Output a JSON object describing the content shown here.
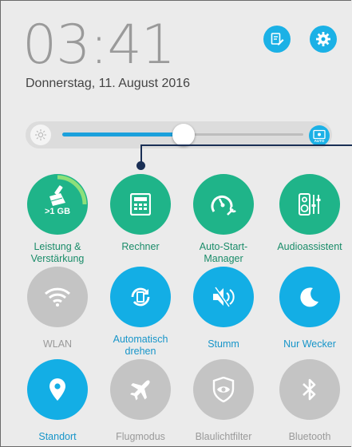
{
  "clock": {
    "time": "03:41",
    "date": "Donnerstag, 11. August 2016"
  },
  "header": {
    "edit_icon": "edit-note-icon",
    "settings_icon": "gear-icon"
  },
  "brightness": {
    "level_percent": 54,
    "auto_label": "AUTO"
  },
  "colors": {
    "green": "#1fb489",
    "blue": "#13aee5",
    "grey": "#c4c4c4",
    "background": "#ebebeb"
  },
  "tiles": [
    {
      "label": "Leistung & Verstärkung",
      "badge": ">1 GB",
      "icon": "broom-icon",
      "active": true
    },
    {
      "label": "Rechner",
      "icon": "calculator-icon",
      "active": true
    },
    {
      "label": "Auto-Start-Manager",
      "icon": "speedometer-wrench-icon",
      "active": true
    },
    {
      "label": "Audioassistent",
      "icon": "speaker-mixer-icon",
      "active": true
    },
    {
      "label": "WLAN",
      "icon": "wifi-icon",
      "active": false
    },
    {
      "label": "Automatisch drehen",
      "icon": "auto-rotate-icon",
      "active": true
    },
    {
      "label": "Stumm",
      "icon": "mute-speaker-icon",
      "active": true
    },
    {
      "label": "Nur Wecker",
      "icon": "moon-icon",
      "active": true
    },
    {
      "label": "Standort",
      "icon": "location-pin-icon",
      "active": true
    },
    {
      "label": "Flugmodus",
      "icon": "airplane-icon",
      "active": false
    },
    {
      "label": "Blaulichtfilter",
      "icon": "eye-shield-icon",
      "active": false
    },
    {
      "label": "Bluetooth",
      "icon": "bluetooth-icon",
      "active": false
    }
  ]
}
